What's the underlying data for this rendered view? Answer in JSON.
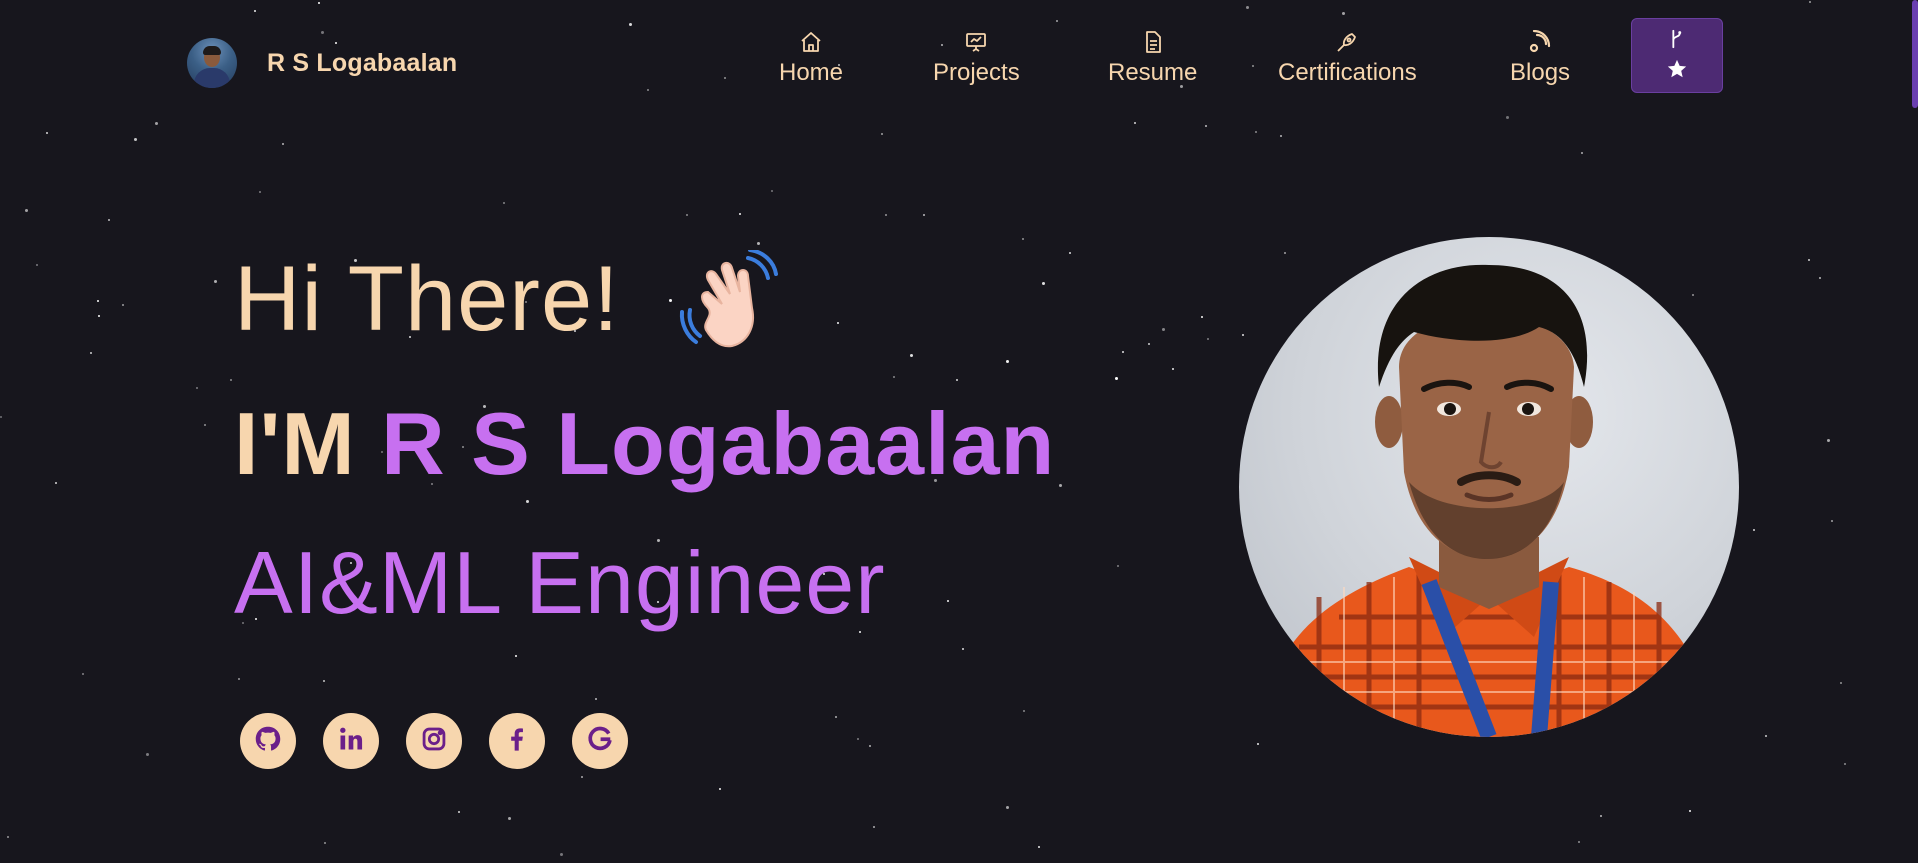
{
  "navbar": {
    "brand_name": "R S Logabaalan",
    "items": [
      {
        "label": "Home",
        "icon": "home-icon"
      },
      {
        "label": "Projects",
        "icon": "presentation-icon"
      },
      {
        "label": "Resume",
        "icon": "document-icon"
      },
      {
        "label": "Certifications",
        "icon": "pen-nib-icon"
      },
      {
        "label": "Blogs",
        "icon": "blog-icon"
      }
    ],
    "fork_button": {
      "icons": [
        "git-branch-icon",
        "star-icon"
      ]
    }
  },
  "hero": {
    "greeting": "Hi There!",
    "wave_emoji": "waving-hand-icon",
    "intro_prefix": "I'M",
    "intro_name": "R S Logabaalan",
    "role": "AI&ML Engineer"
  },
  "socials": [
    {
      "icon": "github-icon"
    },
    {
      "icon": "linkedin-icon"
    },
    {
      "icon": "instagram-icon"
    },
    {
      "icon": "facebook-icon"
    },
    {
      "icon": "google-icon"
    }
  ],
  "colors": {
    "background": "#17161d",
    "accent_purple": "#c770f0",
    "accent_peach": "#f7d6ae",
    "button_purple": "#4d2a73",
    "icon_dark_purple": "#6b1f8a"
  }
}
